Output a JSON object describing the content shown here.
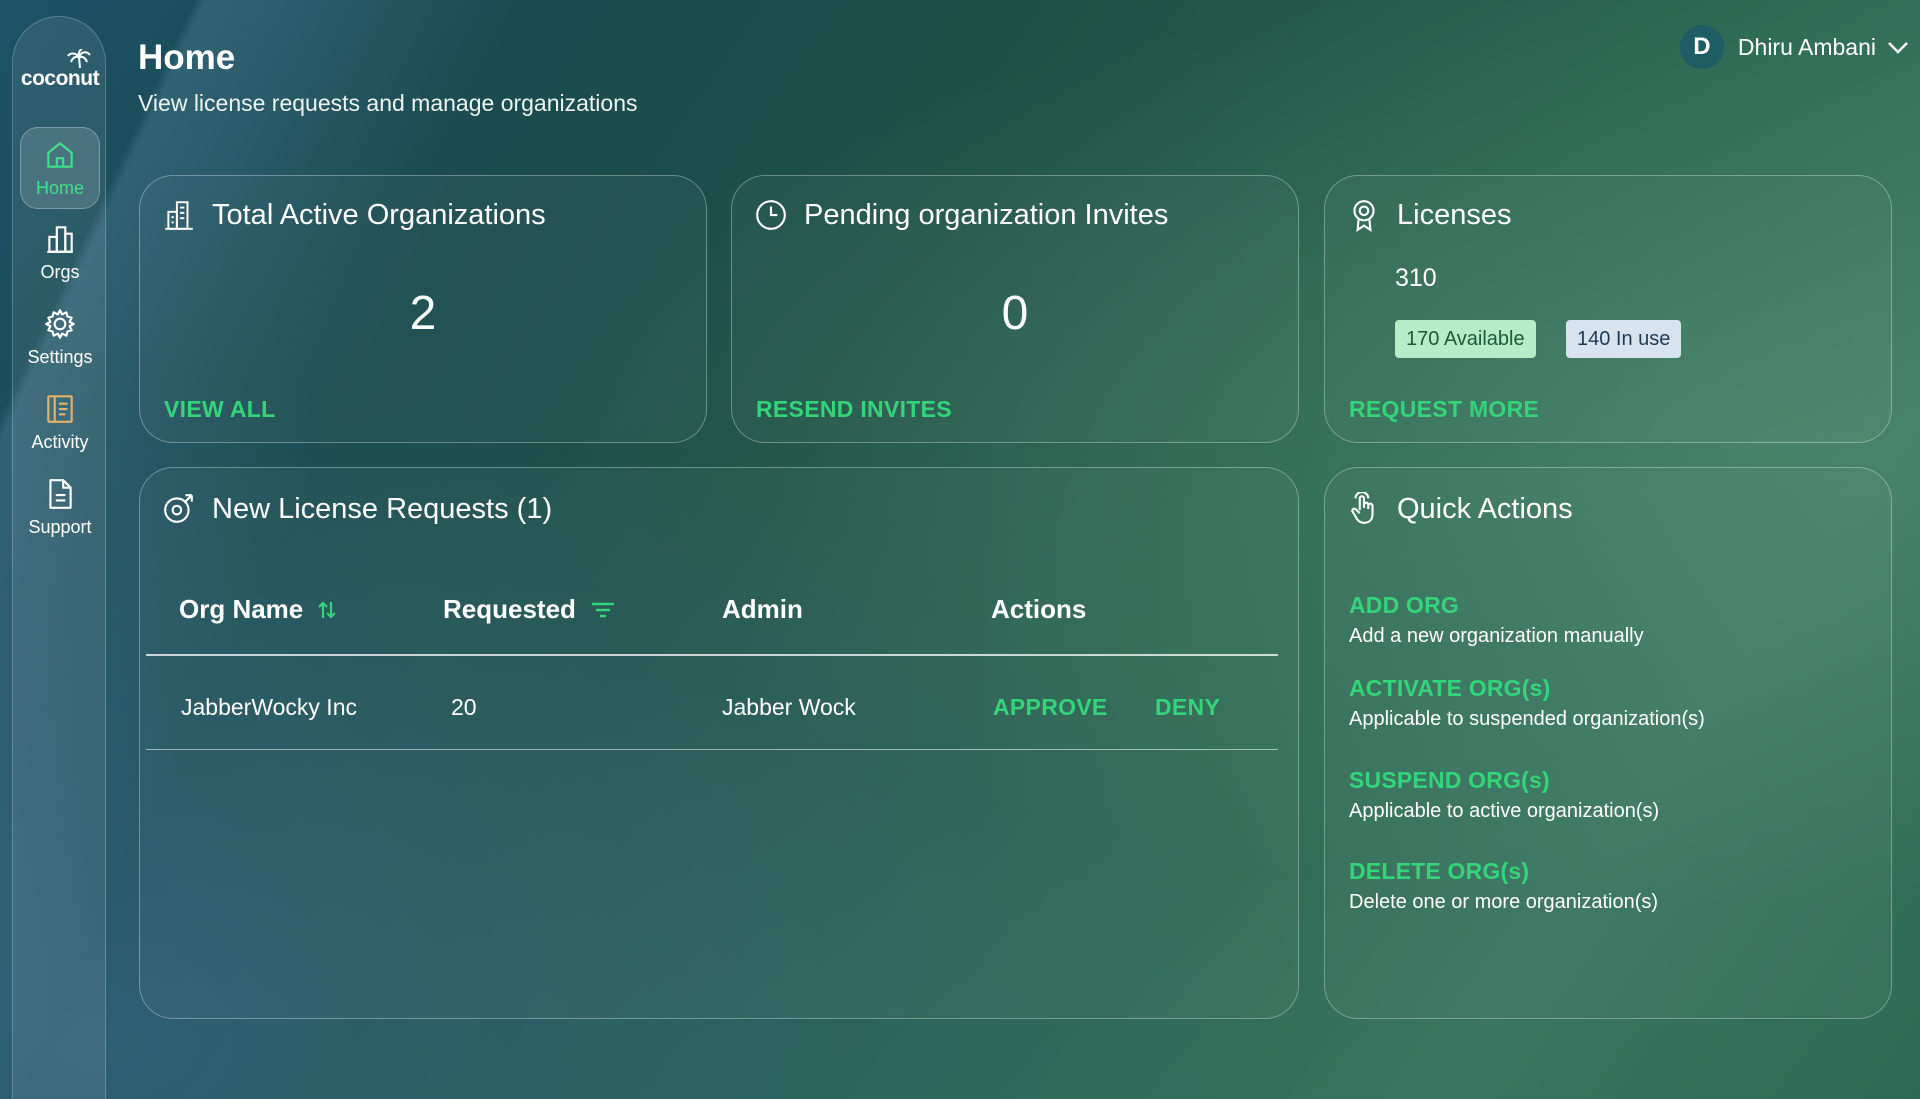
{
  "sidebar": {
    "logo": "coconut",
    "items": [
      {
        "label": "Home",
        "icon": "home-icon",
        "active": true
      },
      {
        "label": "Orgs",
        "icon": "building-icon",
        "active": false
      },
      {
        "label": "Settings",
        "icon": "gear-icon",
        "active": false
      },
      {
        "label": "Activity",
        "icon": "activity-log-icon",
        "active": false
      },
      {
        "label": "Support",
        "icon": "document-icon",
        "active": false
      }
    ]
  },
  "header": {
    "title": "Home",
    "subtitle": "View license requests and manage organizations",
    "user": {
      "initial": "D",
      "name": "Dhiru Ambani"
    }
  },
  "cards": {
    "orgs": {
      "title": "Total Active Organizations",
      "count": "2",
      "link": "VIEW ALL"
    },
    "invites": {
      "title": "Pending organization Invites",
      "count": "0",
      "link": "RESEND INVITES"
    },
    "licenses": {
      "title": "Licenses",
      "total": "310",
      "available": "170 Available",
      "in_use": "140 In use",
      "link": "REQUEST MORE"
    }
  },
  "requests": {
    "title": "New License Requests (1)",
    "columns": {
      "org": "Org Name",
      "requested": "Requested",
      "admin": "Admin",
      "actions": "Actions"
    },
    "rows": [
      {
        "org": "JabberWocky Inc",
        "requested": "20",
        "admin": "Jabber Wock",
        "approve": "APPROVE",
        "deny": "DENY"
      }
    ]
  },
  "quick_actions": {
    "title": "Quick Actions",
    "items": [
      {
        "title": "ADD ORG",
        "desc": "Add a new organization manually"
      },
      {
        "title": "ACTIVATE ORG(s)",
        "desc": "Applicable to suspended organization(s)"
      },
      {
        "title": "SUSPEND ORG(s)",
        "desc": "Applicable to active organization(s)"
      },
      {
        "title": "DELETE ORG(s)",
        "desc": "Delete one or more organization(s)"
      }
    ]
  },
  "colors": {
    "accent": "#33d47a",
    "active_nav": "#3ee08a",
    "badge_available": "#b6edc8",
    "badge_in_use": "#d7e4ef"
  }
}
